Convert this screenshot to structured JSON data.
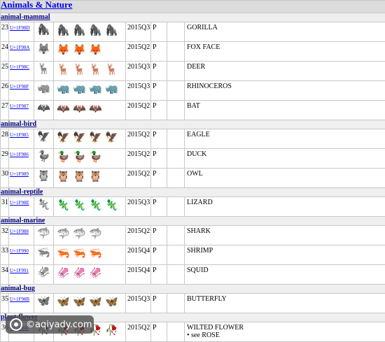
{
  "section_title": "Animals & Nature",
  "groups": [
    {
      "header": "animal-mammal",
      "rows": [
        {
          "num": "23",
          "code": "U+1F98D",
          "bw": "🦍",
          "imgs": [
            "🦍",
            "🦍",
            "🦍",
            "🦍"
          ],
          "version": "2015Q3",
          "status": "P",
          "name": "GORILLA",
          "note": ""
        },
        {
          "num": "24",
          "code": "U+1F98A",
          "bw": "🦊",
          "imgs": [
            "🦊",
            "🦊",
            "🦊"
          ],
          "version": "2015Q2",
          "status": "P",
          "name": "FOX FACE",
          "note": ""
        },
        {
          "num": "25",
          "code": "U+1F98C",
          "bw": "🦌",
          "imgs": [
            "🦌",
            "🦌",
            "🦌",
            "🦌"
          ],
          "version": "2015Q3",
          "status": "P",
          "name": "DEER",
          "note": ""
        },
        {
          "num": "26",
          "code": "U+1F98F",
          "bw": "🦏",
          "imgs": [
            "🦏",
            "🦏",
            "🦏",
            "🦏"
          ],
          "version": "2015Q3",
          "status": "P",
          "name": "RHINOCEROS",
          "note": ""
        },
        {
          "num": "27",
          "code": "U+1F987",
          "bw": "🦇",
          "imgs": [
            "🦇",
            "🦇",
            "🦇"
          ],
          "version": "2015Q2",
          "status": "P",
          "name": "BAT",
          "note": ""
        }
      ]
    },
    {
      "header": "animal-bird",
      "rows": [
        {
          "num": "28",
          "code": "U+1F985",
          "bw": "🦅",
          "imgs": [
            "🦅",
            "🦅",
            "🦅",
            "🦅"
          ],
          "version": "2015Q2",
          "status": "P",
          "name": "EAGLE",
          "note": ""
        },
        {
          "num": "29",
          "code": "U+1F986",
          "bw": "🦆",
          "imgs": [
            "🦆",
            "🦆",
            "🦆"
          ],
          "version": "2015Q2",
          "status": "P",
          "name": "DUCK",
          "note": ""
        },
        {
          "num": "30",
          "code": "U+1F989",
          "bw": "🦉",
          "imgs": [
            "🦉",
            "🦉",
            "🦉"
          ],
          "version": "2015Q2",
          "status": "P",
          "name": "OWL",
          "note": ""
        }
      ]
    },
    {
      "header": "animal-reptile",
      "rows": [
        {
          "num": "31",
          "code": "U+1F98E",
          "bw": "🦎",
          "imgs": [
            "🦎",
            "🦎",
            "🦎",
            "🦎"
          ],
          "version": "2015Q3",
          "status": "P",
          "name": "LIZARD",
          "note": ""
        }
      ]
    },
    {
      "header": "animal-marine",
      "rows": [
        {
          "num": "32",
          "code": "U+1F988",
          "bw": "🦈",
          "imgs": [
            "🦈",
            "🦈",
            "🦈"
          ],
          "version": "2015Q2",
          "status": "P",
          "name": "SHARK",
          "note": ""
        },
        {
          "num": "33",
          "code": "U+1F990",
          "bw": "🦐",
          "imgs": [
            "🦐",
            "🦐",
            "🦐"
          ],
          "version": "2015Q4",
          "status": "P",
          "name": "SHRIMP",
          "note": ""
        },
        {
          "num": "34",
          "code": "U+1F991",
          "bw": "🦑",
          "imgs": [
            "🦑",
            "🦑",
            "🦑"
          ],
          "version": "2015Q4",
          "status": "P",
          "name": "SQUID",
          "note": ""
        }
      ]
    },
    {
      "header": "animal-bug",
      "rows": [
        {
          "num": "35",
          "code": "U+1F98B",
          "bw": "🦋",
          "imgs": [
            "🦋",
            "🦋",
            "🦋",
            "🦋"
          ],
          "version": "2015Q3",
          "status": "P",
          "name": "BUTTERFLY",
          "note": ""
        }
      ]
    },
    {
      "header": "plant-flower",
      "rows": [
        {
          "num": "36",
          "code": "U+1F940",
          "bw": "🥀",
          "imgs": [
            "🥀",
            "🥀",
            "🥀",
            "🥀"
          ],
          "version": "2015Q2",
          "status": "P",
          "name": "WILTED FLOWER",
          "note": "• see ROSE"
        }
      ]
    }
  ],
  "watermark": "©aqiyady.com",
  "colors": {
    "link": "#0000ee",
    "header_bg": "#dcdcdc",
    "subheader_bg": "#efefef",
    "border": "#c8c8c8"
  }
}
